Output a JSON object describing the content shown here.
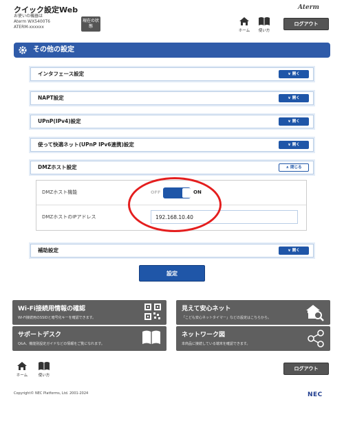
{
  "header": {
    "title": "クイック設定Web",
    "device_caption": "お使いの機器は",
    "device_model": "Aterm WX5400T6",
    "device_id": "ATERM-xxxxxx",
    "status_button": "現在の状態",
    "brand": "Aterm",
    "nav_home": "ホーム",
    "nav_help": "使い方",
    "logout": "ログアウト"
  },
  "page_title": "その他の設定",
  "sections": [
    {
      "label": "インタフェース設定",
      "button": "開く"
    },
    {
      "label": "NAPT設定",
      "button": "開く"
    },
    {
      "label": "UPnP(IPv4)設定",
      "button": "開く"
    },
    {
      "label": "使って快適ネット(UPnP IPv6連携)設定",
      "button": "開く"
    },
    {
      "label": "DMZホスト設定",
      "button": "閉じる"
    },
    {
      "label": "補助設定",
      "button": "開く"
    }
  ],
  "dmz": {
    "function_label": "DMZホスト機能",
    "toggle_off": "OFF",
    "toggle_on": "ON",
    "toggle_state": "ON",
    "ip_label": "DMZホストのIPアドレス",
    "ip_value": "192.168.10.40"
  },
  "submit_button": "設定",
  "cards": [
    {
      "title": "Wi-Fi接続用情報の確認",
      "desc": "Wi-Fi接続用のSSIDと暗号化キーを確認できます。",
      "icon": "qr-code-icon"
    },
    {
      "title": "見えて安心ネット",
      "desc": "「こども安心ネットタイマー」などの設定はこちらから。",
      "icon": "home-search-icon"
    },
    {
      "title": "サポートデスク",
      "desc": "Q&A、機能別設定ガイドなどの情報をご覧になれます。",
      "icon": "book-icon"
    },
    {
      "title": "ネットワーク図",
      "desc": "本商品に接続している端末を確認できます。",
      "icon": "network-icon"
    }
  ],
  "footer": {
    "nav_home": "ホーム",
    "nav_help": "使い方",
    "logout": "ログアウト",
    "copyright": "Copyright© NEC Platforms, Ltd. 2001-2024",
    "logo": "NEC"
  },
  "colors": {
    "accent": "#1f56a8",
    "title_bar": "#2f5ba9",
    "card": "#5f5f5f",
    "highlight": "#e41e1e"
  }
}
